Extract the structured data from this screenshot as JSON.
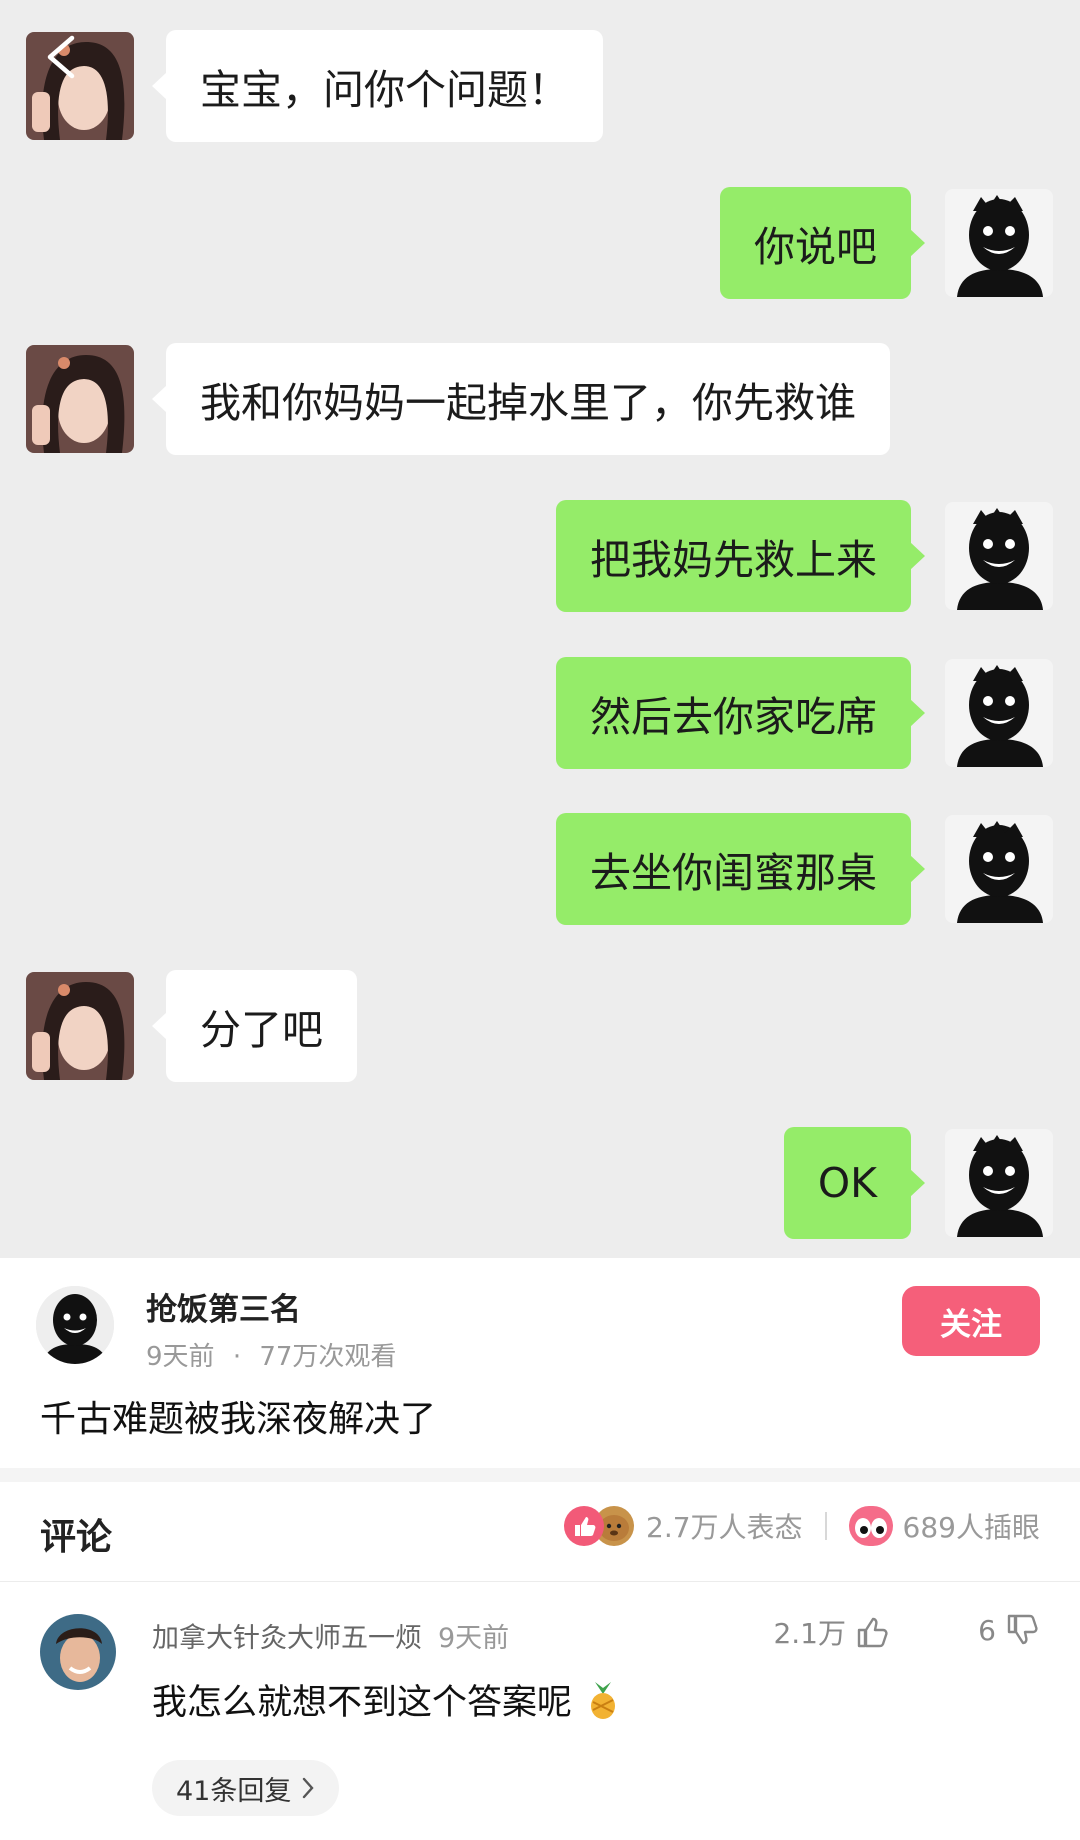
{
  "chat": {
    "messages": [
      {
        "side": "left",
        "text": "宝宝，问你个问题！"
      },
      {
        "side": "right",
        "text": "你说吧"
      },
      {
        "side": "left",
        "text": "我和你妈妈一起掉水里了，你先救谁"
      },
      {
        "side": "right",
        "text": "把我妈先救上来"
      },
      {
        "side": "right",
        "text": "然后去你家吃席"
      },
      {
        "side": "right",
        "text": "去坐你闺蜜那桌"
      },
      {
        "side": "left",
        "text": "分了吧"
      },
      {
        "side": "right",
        "text": "OK"
      }
    ]
  },
  "post": {
    "author": "抢饭第三名",
    "time": "9天前",
    "dot": "·",
    "views": "77万次观看",
    "follow_label": "关注",
    "caption": "千古难题被我深夜解决了"
  },
  "comments_header": {
    "title": "评论",
    "reactions_count": "2.7万人表态",
    "pokes_count": "689人插眼"
  },
  "comment": {
    "user": "加拿大针灸大师五一烦",
    "time": "9天前",
    "likes": "2.1万",
    "dislikes": "6",
    "text": "我怎么就想不到这个答案呢",
    "replies_label": "41条回复"
  },
  "colors": {
    "chat_bg": "#ededed",
    "bubble_right": "#95ec69",
    "bubble_left": "#ffffff",
    "follow_button": "#f55f7a"
  }
}
